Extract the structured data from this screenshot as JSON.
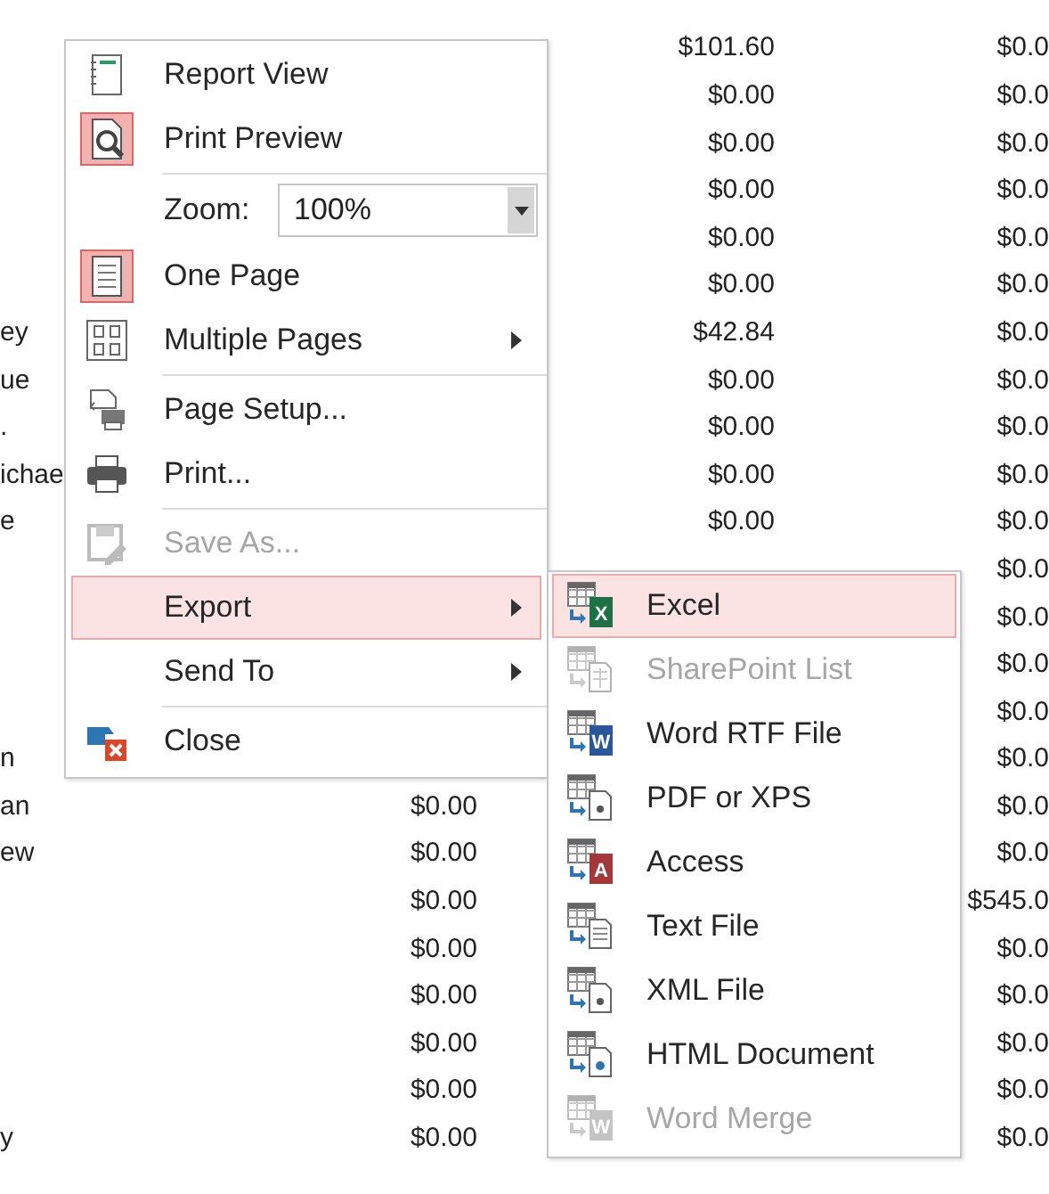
{
  "report": {
    "rows": [
      {
        "column_3": "$101.60",
        "column_4": "$0.0"
      },
      {
        "column_3": "$0.00",
        "column_4": "$0.0"
      },
      {
        "column_3": "$0.00",
        "column_4": "$0.0"
      },
      {
        "column_3": "$0.00",
        "column_4": "$0.0"
      },
      {
        "column_3": "$0.00",
        "column_4": "$0.0"
      },
      {
        "column_3": "$0.00",
        "column_4": "$0.0"
      },
      {
        "column_1": "ey",
        "column_3": "$42.84",
        "column_4": "$0.0"
      },
      {
        "column_1": "ue",
        "column_3": "$0.00",
        "column_4": "$0.0"
      },
      {
        "column_1": ".",
        "column_3": "$0.00",
        "column_4": "$0.0"
      },
      {
        "column_1": "ichae",
        "column_3": "$0.00",
        "column_4": "$0.0"
      },
      {
        "column_1": "e",
        "column_3": "$0.00",
        "column_4": "$0.0"
      },
      {
        "column_4": "$0.0"
      },
      {
        "column_4": "$0.0"
      },
      {
        "column_4": "$0.0"
      },
      {
        "column_4": "$0.0"
      },
      {
        "column_1": "n",
        "column_4": "$0.0"
      },
      {
        "column_1": "an",
        "column_2": "$0.00",
        "column_4": "$0.0"
      },
      {
        "column_1": "ew",
        "column_2": "$0.00",
        "column_4": "$0.0"
      },
      {
        "column_2": "$0.00",
        "column_4": "$545.0"
      },
      {
        "column_2": "$0.00",
        "column_4": "$0.0"
      },
      {
        "column_2": "$0.00",
        "column_4": "$0.0"
      },
      {
        "column_2": "$0.00",
        "column_4": "$0.0"
      },
      {
        "column_2": "$0.00",
        "column_4": "$0.0"
      },
      {
        "column_1": "y",
        "column_2": "$0.00",
        "column_4": "$0.0"
      }
    ]
  },
  "context_menu": {
    "items": [
      {
        "kind": "command",
        "label": "Report View",
        "checked": false,
        "disabled": false,
        "selected": false,
        "submenu": false
      },
      {
        "kind": "command",
        "label": "Print Preview",
        "checked": true,
        "disabled": false,
        "selected": false,
        "submenu": false
      },
      {
        "kind": "separator"
      },
      {
        "kind": "zoom",
        "label": "Zoom:",
        "value": "100%"
      },
      {
        "kind": "command",
        "label": "One Page",
        "checked": true,
        "disabled": false,
        "selected": false,
        "submenu": false
      },
      {
        "kind": "command",
        "label": "Multiple Pages",
        "checked": false,
        "disabled": false,
        "selected": false,
        "submenu": true
      },
      {
        "kind": "separator"
      },
      {
        "kind": "command",
        "label": "Page Setup...",
        "checked": false,
        "disabled": false,
        "selected": false,
        "submenu": false
      },
      {
        "kind": "command",
        "label": "Print...",
        "checked": false,
        "disabled": false,
        "selected": false,
        "submenu": false
      },
      {
        "kind": "separator"
      },
      {
        "kind": "command",
        "label": "Save As...",
        "checked": false,
        "disabled": true,
        "selected": false,
        "submenu": false
      },
      {
        "kind": "command",
        "label": "Export",
        "checked": false,
        "disabled": false,
        "selected": true,
        "submenu": true
      },
      {
        "kind": "command",
        "label": "Send To",
        "checked": false,
        "disabled": false,
        "selected": false,
        "submenu": true
      },
      {
        "kind": "separator"
      },
      {
        "kind": "command",
        "label": "Close",
        "checked": false,
        "disabled": false,
        "selected": false,
        "submenu": false
      }
    ]
  },
  "export_submenu": {
    "items": [
      {
        "label": "Excel",
        "badge": "X",
        "disabled": false,
        "selected": true
      },
      {
        "label": "SharePoint List",
        "disabled": true,
        "selected": false
      },
      {
        "label": "Word RTF File",
        "badge": "W",
        "disabled": false,
        "selected": false
      },
      {
        "label": "PDF or XPS",
        "disabled": false,
        "selected": false
      },
      {
        "label": "Access",
        "badge": "A",
        "disabled": false,
        "selected": false
      },
      {
        "label": "Text File",
        "disabled": false,
        "selected": false
      },
      {
        "label": "XML File",
        "disabled": false,
        "selected": false
      },
      {
        "label": "HTML Document",
        "disabled": false,
        "selected": false
      },
      {
        "label": "Word Merge",
        "badge": "W",
        "disabled": true,
        "selected": false
      }
    ]
  }
}
